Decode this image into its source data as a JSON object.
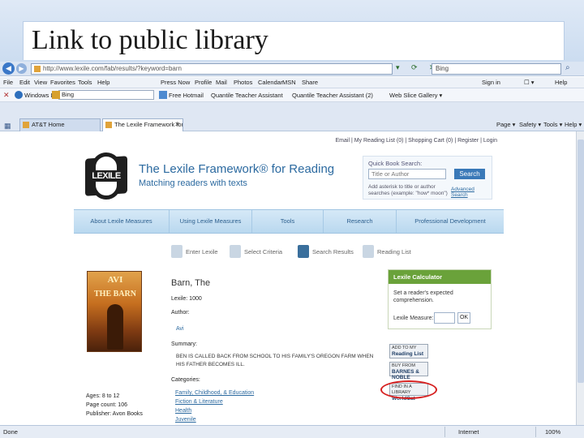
{
  "slide": {
    "title": "Link to public library"
  },
  "browser": {
    "address_url": "http://www.lexile.com/fab/results/?keyword=barn",
    "search_engine_placeholder": "Bing",
    "nav_icons": "▾ ⟳ ✕",
    "menu": [
      "File",
      "Edit",
      "View",
      "Favorites",
      "Tools",
      "Help"
    ],
    "menu_right": [
      "Press Now",
      "Profile",
      "Mail",
      "Photos",
      "Calendar",
      "MSN",
      "Share"
    ],
    "menu_far_right": [
      "Sign in",
      "☐ ▾",
      "Help"
    ],
    "links_toolbar": {
      "close_glyph": "✕",
      "search_label": "Windows Live",
      "search_value": "Bing",
      "items": [
        "Free Hotmail",
        "Quantile Teacher Assistant",
        "Quantile Teacher Assistant (2)",
        "Web Slice Gallery ▾"
      ]
    },
    "tabs": [
      {
        "label": "AT&T Home"
      },
      {
        "label": "The Lexile Framework for R...",
        "active": true
      }
    ],
    "right_tools": [
      "Page ▾",
      "Safety ▾",
      "Tools ▾",
      "Help ▾"
    ],
    "status": {
      "left": "Done",
      "zone": "Internet",
      "zoom": "100%"
    }
  },
  "site": {
    "top_links": "Email | My Reading List (0) | Shopping Cart (0) | Register | Login",
    "logo_text": "LEXILE",
    "brand_title": "The Lexile Framework® for Reading",
    "brand_subtitle": "Matching readers with texts",
    "quick_search": {
      "title": "Quick Book Search:",
      "placeholder": "Title or Author",
      "button": "Search",
      "hint": "Add asterisk to title or author searches (example: \"how* moon\")",
      "advanced": "Advanced Search"
    },
    "nav": [
      "About Lexile Measures",
      "Using Lexile Measures",
      "Tools",
      "Research",
      "Professional Development"
    ],
    "steps": [
      "Enter Lexile",
      "Select Criteria",
      "Search Results",
      "Reading List"
    ],
    "book": {
      "cover_author": "AVI",
      "cover_title": "THE BARN",
      "title": "Barn, The",
      "lexile_label": "Lexile: 1000",
      "author_label": "Author:",
      "author_value": "Avi",
      "summary_label": "Summary:",
      "summary_text": "BEN IS CALLED BACK FROM SCHOOL TO HIS FAMILY'S OREGON FARM WHEN HIS FATHER BECOMES ILL.",
      "categories_label": "Categories:",
      "categories": [
        "Family, Childhood, & Education",
        "Fiction & Literature",
        "Health",
        "Juvenile"
      ],
      "ages": "Ages: 8 to 12",
      "page_count": "Page count: 106",
      "publisher": "Publisher: Avon Books"
    },
    "calculator": {
      "heading": "Lexile Calculator",
      "text": "Set a reader's expected comprehension.",
      "measure_label": "Lexile Measure:",
      "ok": "OK"
    },
    "buttons": {
      "reading_list_top": "ADD TO MY",
      "reading_list": "Reading List",
      "bn_top": "BUY FROM",
      "bn": "BARNES & NOBLE",
      "worldcat_top": "FIND IN A LIBRARY",
      "worldcat": "WorldCat"
    }
  }
}
